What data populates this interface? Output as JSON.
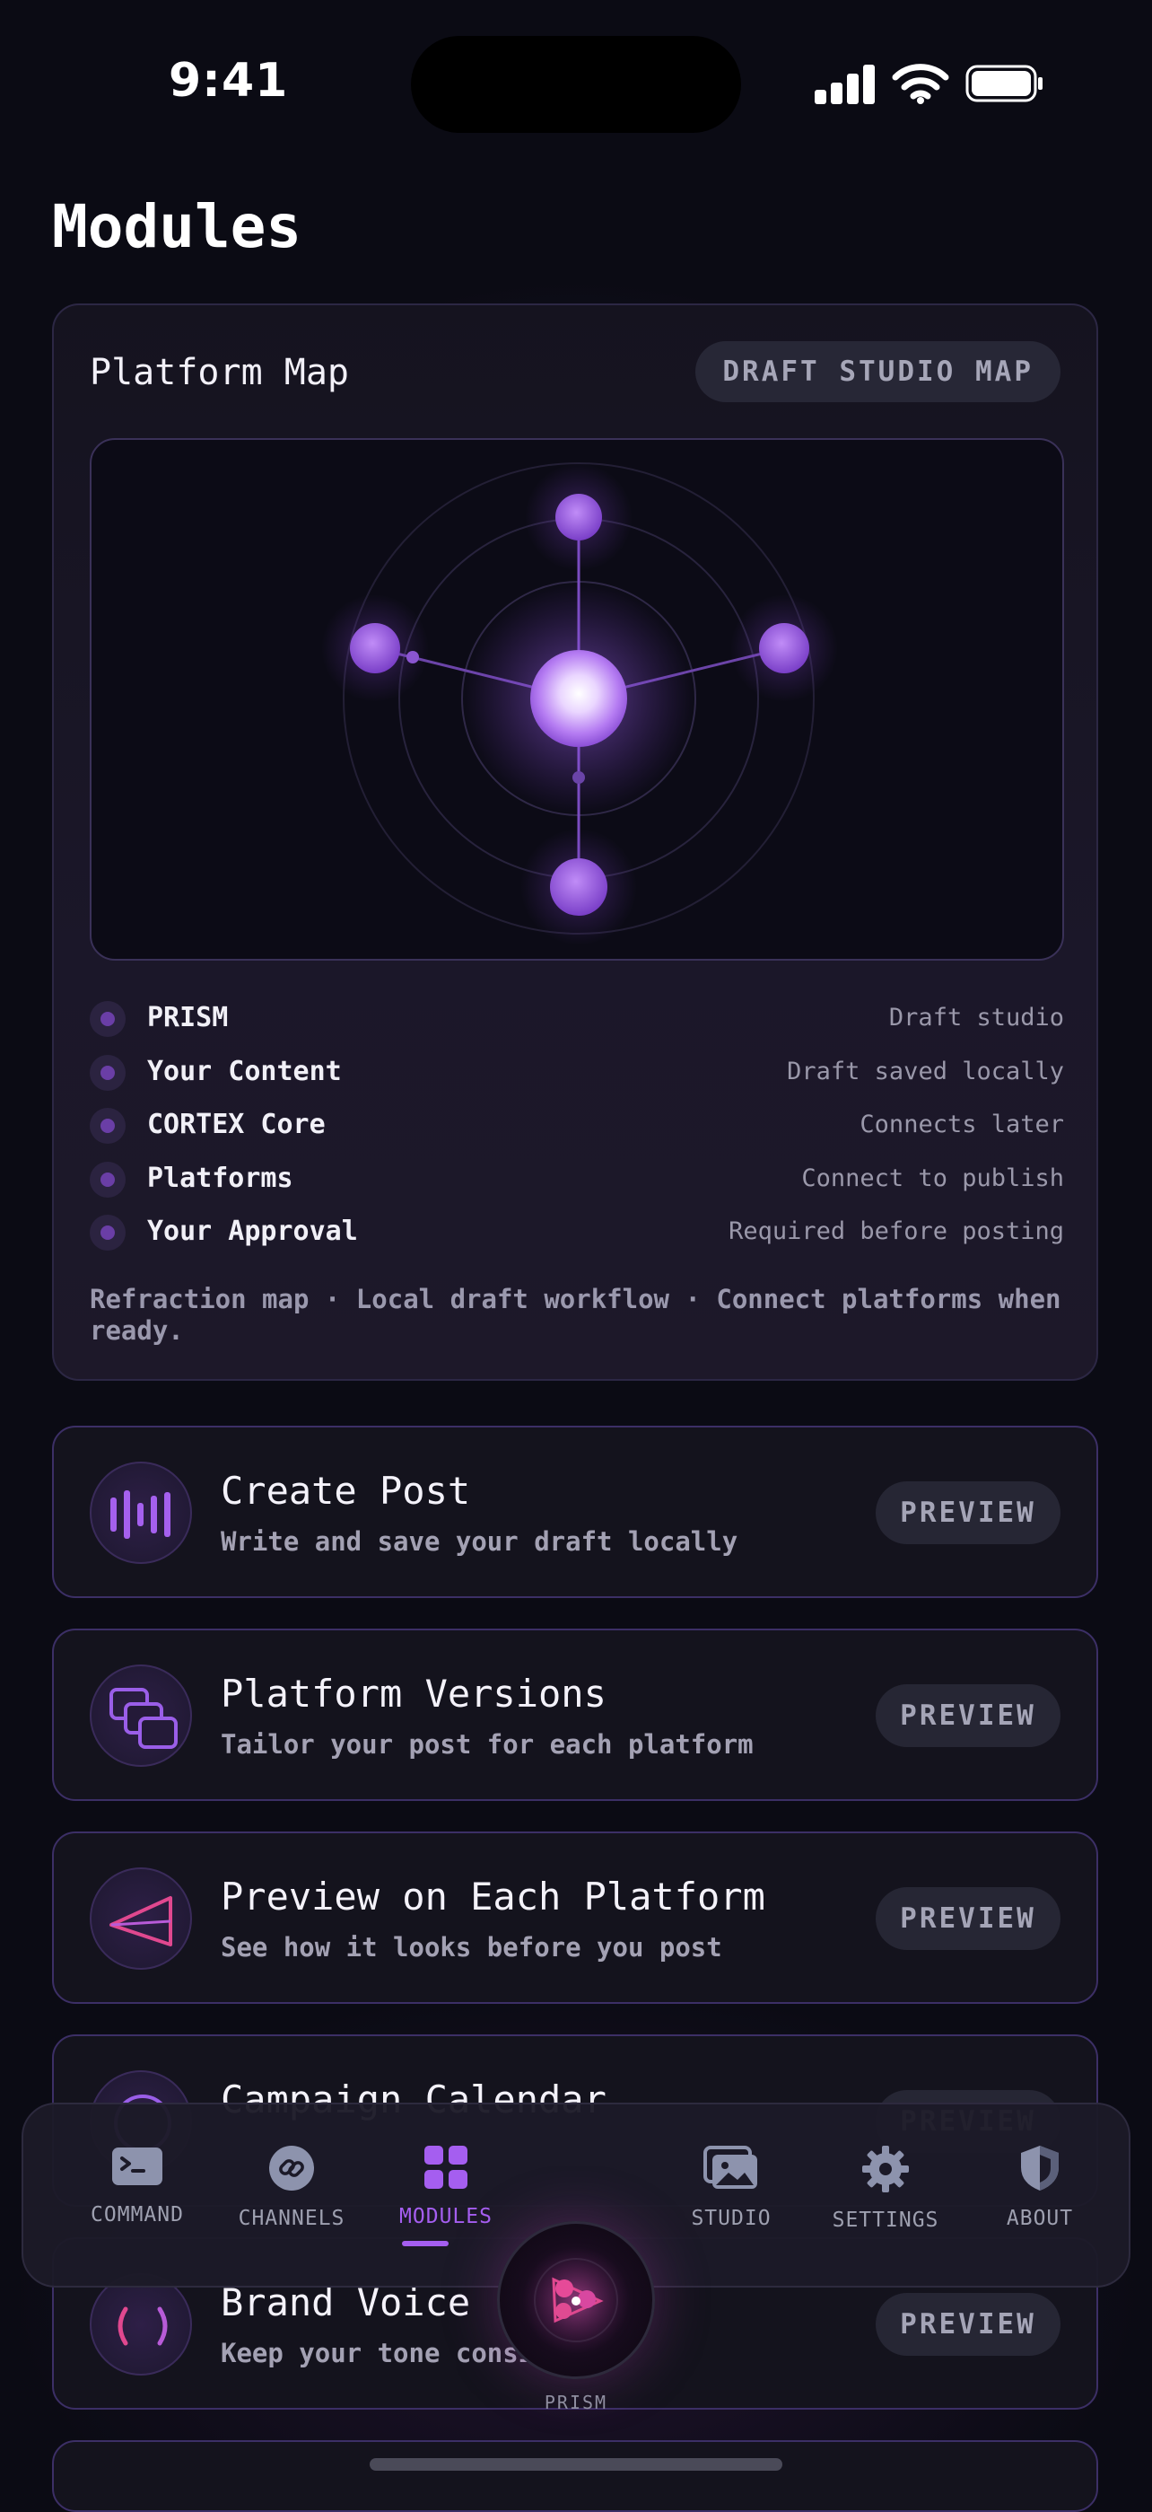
{
  "status_bar": {
    "time": "9:41"
  },
  "page": {
    "title": "Modules"
  },
  "platform_map": {
    "title": "Platform Map",
    "badge": "DRAFT STUDIO MAP",
    "legend": [
      {
        "name": "PRISM",
        "value": "Draft studio"
      },
      {
        "name": "Your Content",
        "value": "Draft saved locally"
      },
      {
        "name": "CORTEX Core",
        "value": "Connects later"
      },
      {
        "name": "Platforms",
        "value": "Connect to publish"
      },
      {
        "name": "Your Approval",
        "value": "Required before posting"
      }
    ],
    "footer": "Refraction map · Local draft workflow · Connect platforms when ready.",
    "accent_color": "#a55ef0"
  },
  "modules": [
    {
      "title": "Create Post",
      "subtitle": "Write and save your draft locally",
      "action": "PREVIEW",
      "icon": "waveform-icon"
    },
    {
      "title": "Platform Versions",
      "subtitle": "Tailor your post for each platform",
      "action": "PREVIEW",
      "icon": "stacked-windows-icon"
    },
    {
      "title": "Preview on Each Platform",
      "subtitle": "See how it looks before you post",
      "action": "PREVIEW",
      "icon": "prism-triangle-icon"
    },
    {
      "title": "Campaign Calendar",
      "subtitle": "",
      "action": "PREVIEW",
      "icon": "calendar-icon"
    },
    {
      "title": "Brand Voice",
      "subtitle": "Keep your tone consistent",
      "action": "PREVIEW",
      "icon": "brackets-icon"
    }
  ],
  "nav": {
    "items": [
      {
        "label": "COMMAND",
        "icon": "terminal-icon"
      },
      {
        "label": "CHANNELS",
        "icon": "link-icon"
      },
      {
        "label": "MODULES",
        "icon": "grid-icon",
        "active": true
      },
      {
        "label": "STUDIO",
        "icon": "photos-icon"
      },
      {
        "label": "SETTINGS",
        "icon": "gear-icon"
      },
      {
        "label": "ABOUT",
        "icon": "shield-icon"
      }
    ],
    "center": {
      "label": "PRISM",
      "icon": "prism-icon"
    }
  }
}
